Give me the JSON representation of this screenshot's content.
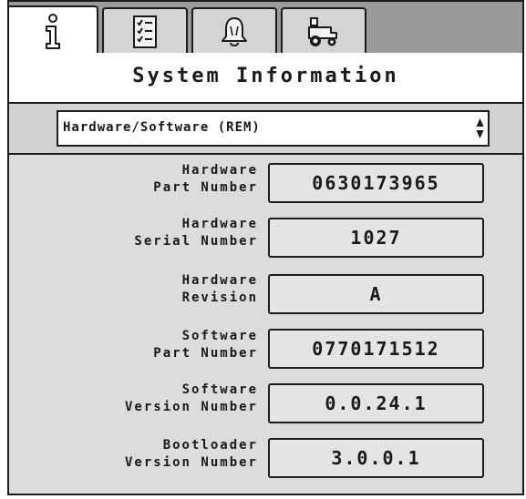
{
  "tabs": [
    {
      "name": "info",
      "icon": "info-icon",
      "active": true
    },
    {
      "name": "checklist",
      "icon": "checklist-icon",
      "active": false
    },
    {
      "name": "alarms",
      "icon": "alarm-bell-icon",
      "active": false
    },
    {
      "name": "vehicle",
      "icon": "tractor-icon",
      "active": false
    }
  ],
  "page": {
    "title": "System Information"
  },
  "selector": {
    "value": "Hardware/Software (REM)"
  },
  "fields": [
    {
      "label_line1": "Hardware",
      "label_line2": "Part Number",
      "value": "0630173965"
    },
    {
      "label_line1": "Hardware",
      "label_line2": "Serial Number",
      "value": "1027"
    },
    {
      "label_line1": "Hardware",
      "label_line2": "Revision",
      "value": "A"
    },
    {
      "label_line1": "Software",
      "label_line2": "Part Number",
      "value": "0770171512"
    },
    {
      "label_line1": "Software",
      "label_line2": "Version Number",
      "value": "0.0.24.1"
    },
    {
      "label_line1": "Bootloader",
      "label_line2": "Version Number",
      "value": "3.0.0.1"
    }
  ],
  "colors": {
    "tab_strip": "#9a9a9a",
    "panel": "#dcdcdc",
    "field_bg": "#e4e4e4",
    "border": "#1c1c1c"
  }
}
